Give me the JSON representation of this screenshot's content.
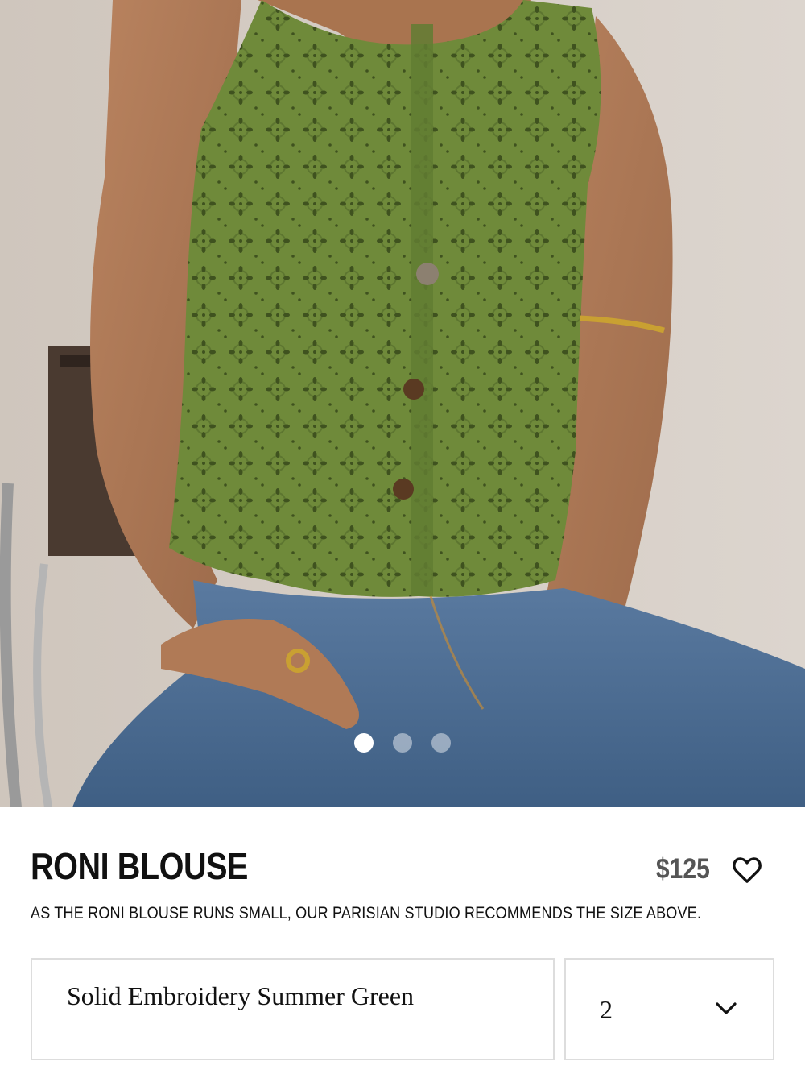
{
  "product": {
    "name": "RONI BLOUSE",
    "price": "$125",
    "size_note": "AS THE RONI BLOUSE RUNS SMALL, OUR PARISIAN STUDIO RECOMMENDS THE SIZE ABOVE."
  },
  "gallery": {
    "slides": 3,
    "active_slide": 1,
    "image_description_icon": "product-photo"
  },
  "options": {
    "color": {
      "value": "Solid Embroidery Summer Green"
    },
    "size": {
      "value": "2"
    }
  },
  "icons": {
    "favorite": "heart-outline-icon",
    "dropdown": "chevron-down-icon"
  },
  "colors": {
    "blouse": "#6f8a3a",
    "denim": "#4b6a8c",
    "background": "#d9d2cb",
    "price_text": "#555555"
  }
}
